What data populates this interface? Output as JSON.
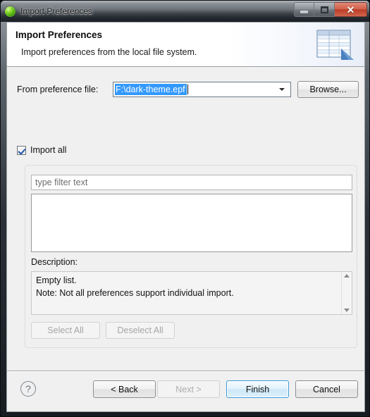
{
  "window": {
    "title": "Import Preferences",
    "app_icon": "green-sphere-icon",
    "controls": {
      "minimize": "minimize-icon",
      "maximize": "restore-icon",
      "close": "✕"
    }
  },
  "banner": {
    "title": "Import Preferences",
    "subtitle": "Import preferences from the local file system.",
    "icon": "preferences-table-icon"
  },
  "file_row": {
    "label": "From preference file:",
    "value": "F:\\dark-theme.epf",
    "dropdown_icon": "chevron-down-icon",
    "browse_label": "Browse..."
  },
  "import_all": {
    "label": "Import all",
    "checked": true
  },
  "group": {
    "filter_placeholder": "type filter text",
    "filter_value": "",
    "list_items": [],
    "description_label": "Description:",
    "description_lines": [
      "Empty list.",
      "Note: Not all preferences support individual import."
    ],
    "scroll_up_icon": "scroll-up-arrow-icon",
    "scroll_down_icon": "scroll-down-arrow-icon",
    "select_all_label": "Select All",
    "deselect_all_label": "Deselect All"
  },
  "footer": {
    "help_icon": "?",
    "back_label": "< Back",
    "next_label": "Next >",
    "finish_label": "Finish",
    "cancel_label": "Cancel"
  },
  "colors": {
    "selection_blue": "#3399ff",
    "default_button_border": "#3d9ad6",
    "close_button_red": "#bc3c26",
    "dialog_background": "#f0f0f0"
  }
}
